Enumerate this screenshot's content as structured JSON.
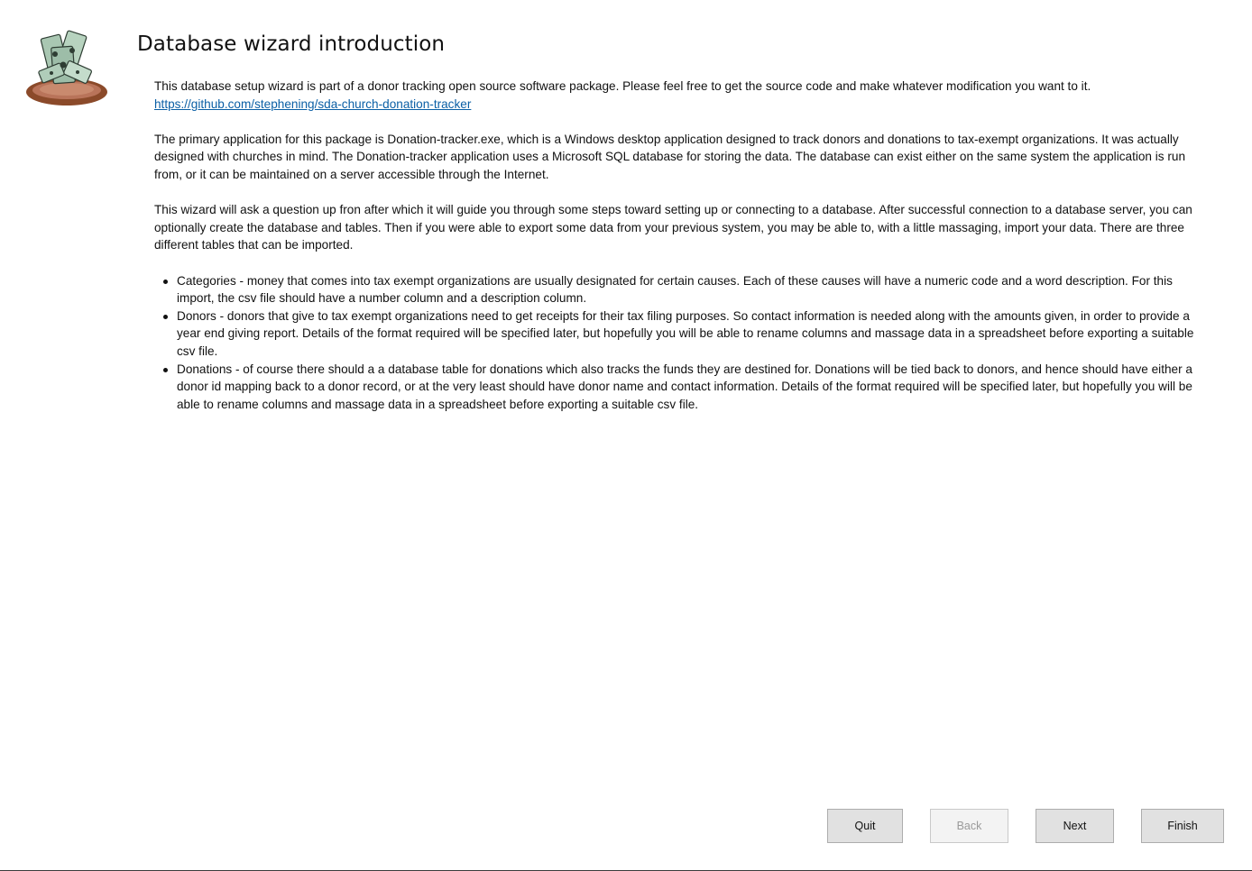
{
  "window": {
    "title": "Database wizard introduction"
  },
  "content": {
    "intro": "This database setup wizard is part of a donor tracking open source software package. Please feel free to get the source code and make whatever modification you want to it.",
    "link": "https://github.com/stephening/sda-church-donation-tracker",
    "paragraph1": "The primary application for this package is Donation-tracker.exe, which is a Windows desktop application designed to track donors and donations to tax-exempt organizations. It was actually designed with churches in mind. The Donation-tracker application uses a Microsoft SQL database for storing the data. The database can exist either on the same system the application is run from, or it can be maintained on a server accessible through the Internet.",
    "paragraph2": "This wizard will ask a question up fron after which it will guide you through some steps toward setting up or connecting to a database. After successful connection to a database server, you can optionally create the database and tables. Then if you were able to export some data from your previous system, you may be able to, with a little massaging, import your data. There are three different tables that can be imported.",
    "bullets": [
      "Categories - money that comes into tax exempt organizations are usually designated for certain causes. Each of these causes will have a numeric code and a word description. For this import, the csv file should have a number column and a description column.",
      "Donors - donors that give to tax exempt organizations need to get receipts for their tax filing purposes. So contact information is needed along with the amounts given, in order to provide a year end giving report. Details of the format required will be specified later, but hopefully you will be able to rename columns and massage data in a spreadsheet before exporting a suitable csv file.",
      "Donations - of course there should a a database table for donations which also tracks the funds they are destined for. Donations will be tied back to donors, and hence should have either a donor id mapping back to a donor record, or at the very least should have donor name and contact information. Details of the format required will be specified later, but hopefully you will be able to rename columns and massage data in a spreadsheet before exporting a suitable csv file."
    ]
  },
  "buttons": {
    "quit": "Quit",
    "back": "Back",
    "next": "Next",
    "finish": "Finish"
  },
  "icons": {
    "logo": "money-offering-plate-icon"
  },
  "colors": {
    "link": "#0b5fa5",
    "button_bg": "#e1e1e1",
    "button_disabled_text": "#9a9a9a"
  }
}
